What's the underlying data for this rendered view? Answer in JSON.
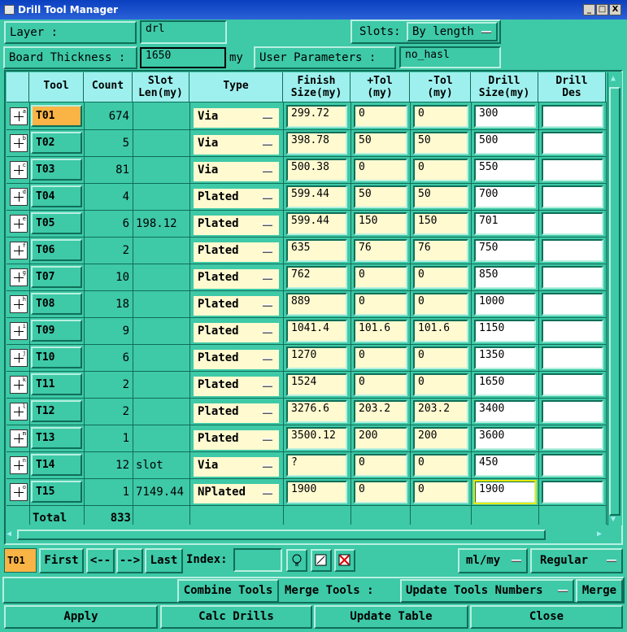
{
  "window": {
    "title": "Drill Tool Manager",
    "minimize": "_",
    "maximize": "□",
    "close": "X"
  },
  "top": {
    "layer_label": "Layer        :",
    "layer_value": "drl",
    "slots_label": "Slots:",
    "slots_value": "By length",
    "board_thickness_label": "Board Thickness :",
    "board_thickness_value": "1650",
    "board_thickness_unit": "my",
    "user_params_label": "User Parameters :",
    "user_params_value": "no_hasl"
  },
  "table": {
    "headers": [
      {
        "l1": "",
        "l2": ""
      },
      {
        "l1": "Tool",
        "l2": ""
      },
      {
        "l1": "Count",
        "l2": ""
      },
      {
        "l1": "Slot",
        "l2": "Len(my)"
      },
      {
        "l1": "Type",
        "l2": ""
      },
      {
        "l1": "Finish",
        "l2": "Size(my)"
      },
      {
        "l1": "+Tol",
        "l2": "(my)"
      },
      {
        "l1": "-Tol",
        "l2": "(my)"
      },
      {
        "l1": "Drill",
        "l2": "Size(my)"
      },
      {
        "l1": "Drill",
        "l2": "Des"
      }
    ],
    "rows": [
      {
        "tool": "T01",
        "count": "674",
        "slot": "",
        "type": "Via",
        "finish": "299.72",
        "ptol": "0",
        "mtol": "0",
        "drill": "300",
        "des": "",
        "tag": "a"
      },
      {
        "tool": "T02",
        "count": "5",
        "slot": "",
        "type": "Via",
        "finish": "398.78",
        "ptol": "50",
        "mtol": "50",
        "drill": "500",
        "des": "",
        "tag": "b"
      },
      {
        "tool": "T03",
        "count": "81",
        "slot": "",
        "type": "Via",
        "finish": "500.38",
        "ptol": "0",
        "mtol": "0",
        "drill": "550",
        "des": "",
        "tag": "c"
      },
      {
        "tool": "T04",
        "count": "4",
        "slot": "",
        "type": "Plated",
        "finish": "599.44",
        "ptol": "50",
        "mtol": "50",
        "drill": "700",
        "des": "",
        "tag": "d"
      },
      {
        "tool": "T05",
        "count": "6",
        "slot": "198.12",
        "type": "Plated",
        "finish": "599.44",
        "ptol": "150",
        "mtol": "150",
        "drill": "701",
        "des": "",
        "tag": "e"
      },
      {
        "tool": "T06",
        "count": "2",
        "slot": "",
        "type": "Plated",
        "finish": "635",
        "ptol": "76",
        "mtol": "76",
        "drill": "750",
        "des": "",
        "tag": "f"
      },
      {
        "tool": "T07",
        "count": "10",
        "slot": "",
        "type": "Plated",
        "finish": "762",
        "ptol": "0",
        "mtol": "0",
        "drill": "850",
        "des": "",
        "tag": "g"
      },
      {
        "tool": "T08",
        "count": "18",
        "slot": "",
        "type": "Plated",
        "finish": "889",
        "ptol": "0",
        "mtol": "0",
        "drill": "1000",
        "des": "",
        "tag": "h"
      },
      {
        "tool": "T09",
        "count": "9",
        "slot": "",
        "type": "Plated",
        "finish": "1041.4",
        "ptol": "101.6",
        "mtol": "101.6",
        "drill": "1150",
        "des": "",
        "tag": "i"
      },
      {
        "tool": "T10",
        "count": "6",
        "slot": "",
        "type": "Plated",
        "finish": "1270",
        "ptol": "0",
        "mtol": "0",
        "drill": "1350",
        "des": "",
        "tag": "j"
      },
      {
        "tool": "T11",
        "count": "2",
        "slot": "",
        "type": "Plated",
        "finish": "1524",
        "ptol": "0",
        "mtol": "0",
        "drill": "1650",
        "des": "",
        "tag": "k"
      },
      {
        "tool": "T12",
        "count": "2",
        "slot": "",
        "type": "Plated",
        "finish": "3276.6",
        "ptol": "203.2",
        "mtol": "203.2",
        "drill": "3400",
        "des": "",
        "tag": "l"
      },
      {
        "tool": "T13",
        "count": "1",
        "slot": "",
        "type": "Plated",
        "finish": "3500.12",
        "ptol": "200",
        "mtol": "200",
        "drill": "3600",
        "des": "",
        "tag": "m"
      },
      {
        "tool": "T14",
        "count": "12",
        "slot": "slot",
        "type": "Via",
        "finish": "?",
        "ptol": "0",
        "mtol": "0",
        "drill": "450",
        "des": "",
        "tag": "n"
      },
      {
        "tool": "T15",
        "count": "1",
        "slot": "7149.44",
        "type": "NPlated",
        "finish": "1900",
        "ptol": "0",
        "mtol": "0",
        "drill": "1900",
        "des": "",
        "tag": "o"
      }
    ],
    "total_label": "Total",
    "total_count": "833"
  },
  "nav": {
    "current": "T01",
    "first": "First",
    "prev": "<--",
    "next": "-->",
    "last": "Last",
    "index_label": "Index:",
    "index_value": "",
    "units": "ml/my",
    "mode": "Regular"
  },
  "actions": {
    "combine": "Combine Tools",
    "merge_tools_label": "Merge Tools :",
    "merge_dd": "Update Tools Numbers",
    "merge": "Merge",
    "apply": "Apply",
    "calc": "Calc Drills",
    "update": "Update Table",
    "close": "Close"
  },
  "colors": {
    "bg": "#3ec9a7",
    "header": "#9ef0ee",
    "input": "#fffad0",
    "highlight": "#f9b445",
    "focus": "#e8e800"
  }
}
